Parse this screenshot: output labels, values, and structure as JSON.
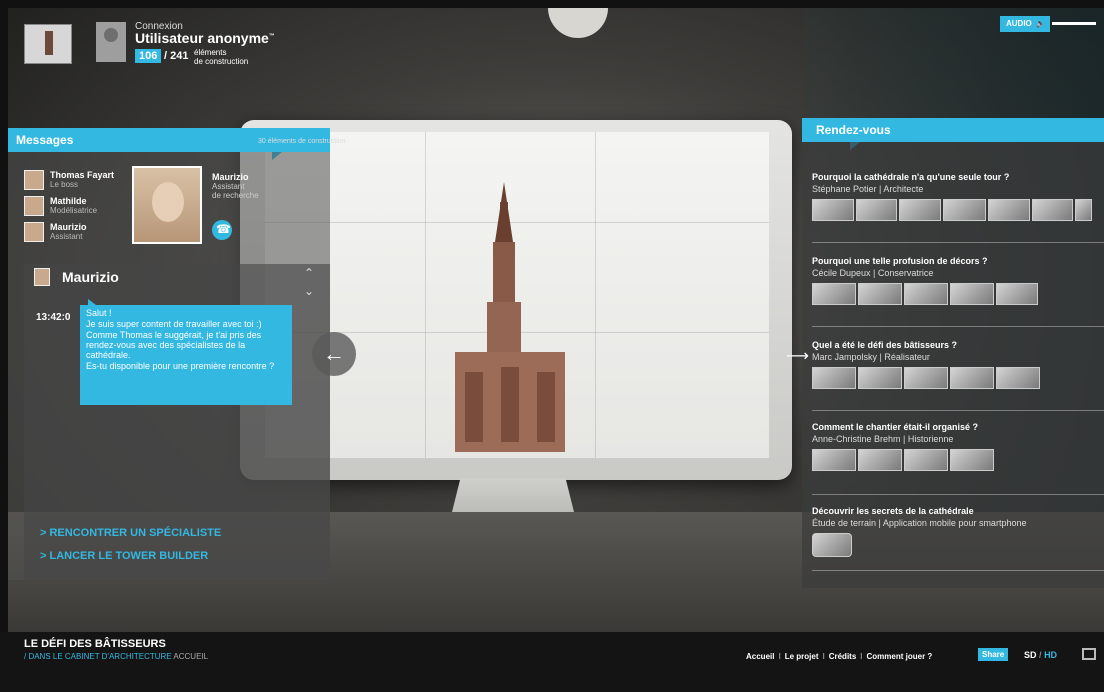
{
  "header": {
    "login_label": "Connexion",
    "user_name": "Utilisateur anonyme",
    "user_trademark": "™",
    "elements_collected": "106",
    "elements_total": "241",
    "elements_label_1": "éléments",
    "elements_label_2": "de construction",
    "audio_label": "AUDIO"
  },
  "messages": {
    "title": "Messages",
    "contacts": [
      {
        "name": "Thomas Fayart",
        "role": "Le boss"
      },
      {
        "name": "Mathilde",
        "role": "Modélisatrice"
      },
      {
        "name": "Maurizio",
        "role": "Assistant"
      }
    ],
    "selected": {
      "name": "Maurizio",
      "role_line1": "Assistant",
      "role_line2": "de recherche",
      "mini_count": "30",
      "mini_label": "éléments de construction"
    },
    "chat": {
      "contact_name": "Maurizio",
      "time": "13:42:0",
      "lines": [
        "Salut !",
        "Je suis super content de travailler avec toi :)",
        "Comme Thomas le suggérait, je t'ai pris des rendez-vous avec des spécialistes de la cathédrale.",
        "Es-tu disponible pour une première rencontre ?"
      ]
    },
    "links": [
      "> RENCONTRER UN SPÉCIALISTE",
      "> LANCER LE TOWER BUILDER"
    ]
  },
  "rendezvous": {
    "title": "Rendez-vous",
    "items": [
      {
        "title": "Pourquoi la cathédrale n'a qu'une seule tour ?",
        "subtitle": "Stéphane Potier | Architecte",
        "thumbs": 7
      },
      {
        "title": "Pourquoi une telle profusion de décors ?",
        "subtitle": "Cécile Dupeux | Conservatrice",
        "thumbs": 5
      },
      {
        "title": "Quel a été le défi des bâtisseurs ?",
        "subtitle": "Marc Jampolsky | Réalisateur",
        "thumbs": 5
      },
      {
        "title": "Comment le chantier était-il organisé ?",
        "subtitle": "Anne-Christine Brehm | Historienne",
        "thumbs": 4
      },
      {
        "title": "Découvrir les secrets de la cathédrale",
        "subtitle": "Étude de terrain | Application mobile pour smartphone",
        "thumbs": 1
      }
    ]
  },
  "footer": {
    "title": "LE DÉFI DES BÂTISSEURS",
    "subtitle_prefix": "/ DANS LE CABINET D'ARCHITECTURE",
    "subtitle_suffix": "ACCUEIL",
    "nav": [
      "Accueil",
      "Le projet",
      "Crédits",
      "Comment jouer ?"
    ],
    "nav_sep": "I",
    "share_label": "Share",
    "sd_label": "SD",
    "sd_sep": "/",
    "hd_label": "HD"
  },
  "colors": {
    "accent": "#33b8e2"
  }
}
